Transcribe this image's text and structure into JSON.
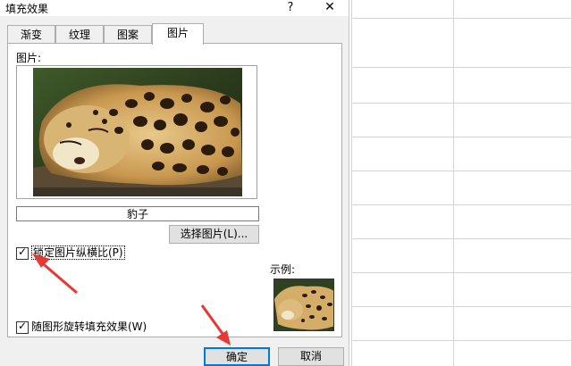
{
  "dialog": {
    "title": "填充效果",
    "help_label": "?",
    "close_label": "✕",
    "tabs": [
      {
        "label": "渐变"
      },
      {
        "label": "纹理"
      },
      {
        "label": "图案"
      },
      {
        "label": "图片"
      }
    ],
    "active_tab": "图片",
    "picture_label": "图片:",
    "picture_name": "豹子",
    "select_button": "选择图片(L)...",
    "lock_aspect_label": "锁定图片纵横比(P)",
    "lock_aspect_checked": true,
    "rotate_with_shape_label": "随图形旋转填充效果(W)",
    "rotate_with_shape_checked": true,
    "sample_label": "示例:",
    "ok_button": "确定",
    "cancel_button": "取消"
  },
  "colors": {
    "annotation_arrow": "#e53935",
    "ok_focus_border": "#0078d7"
  },
  "icons": [
    "help-icon",
    "close-icon",
    "checkbox-checked-icon",
    "annotation-arrow"
  ]
}
